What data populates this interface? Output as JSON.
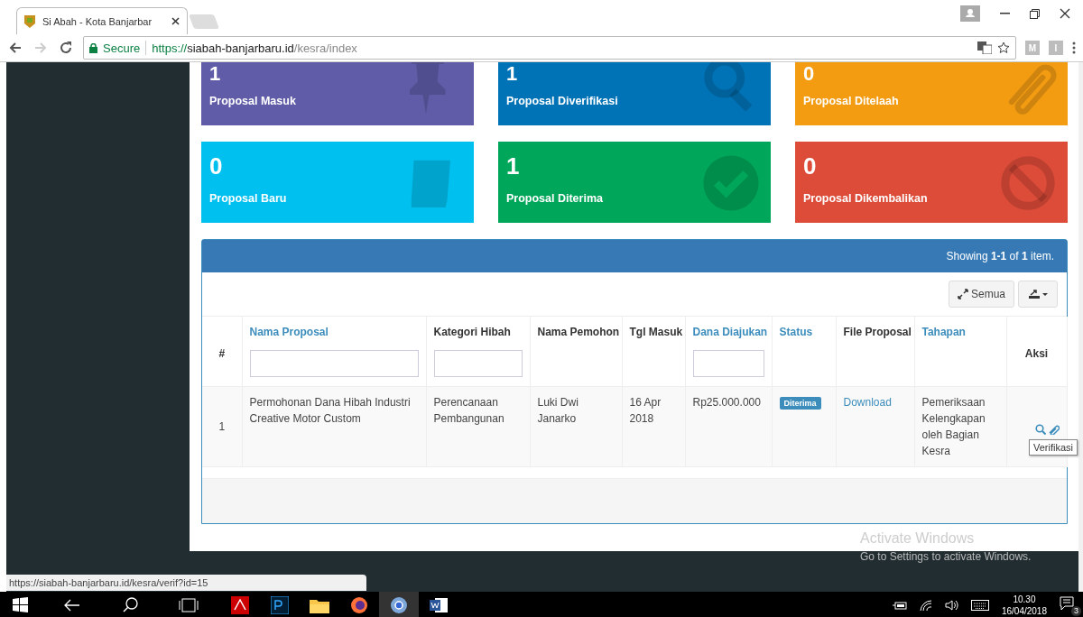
{
  "browser": {
    "tab_title": "Si Abah - Kota Banjarbar",
    "secure_label": "Secure",
    "url_scheme": "https://",
    "url_host": "siabah-banjarbaru.id",
    "url_path": "/kesra/index",
    "extensions": [
      "M",
      "I"
    ]
  },
  "tiles": [
    {
      "number": "1",
      "label": "Proposal Masuk",
      "color": "#605ca8"
    },
    {
      "number": "1",
      "label": "Proposal Diverifikasi",
      "color": "#0073b7"
    },
    {
      "number": "0",
      "label": "Proposal Ditelaah",
      "color": "#f39c12"
    },
    {
      "number": "0",
      "label": "Proposal Baru",
      "color": "#00c0ef"
    },
    {
      "number": "1",
      "label": "Proposal Diterima",
      "color": "#00a65a"
    },
    {
      "number": "0",
      "label": "Proposal Dikembalikan",
      "color": "#dd4b39"
    }
  ],
  "table": {
    "summary": "Showing **1-1** of **1** item.",
    "expand_button": "Semua",
    "columns": [
      {
        "label": "#",
        "sortable": false,
        "filter": false
      },
      {
        "label": "Nama Proposal",
        "sortable": true,
        "filter": true
      },
      {
        "label": "Kategori Hibah",
        "sortable": false,
        "filter": true
      },
      {
        "label": "Nama Pemohon",
        "sortable": false,
        "filter": false
      },
      {
        "label": "Tgl Masuk",
        "sortable": false,
        "filter": false
      },
      {
        "label": "Dana Diajukan",
        "sortable": true,
        "filter": true
      },
      {
        "label": "Status",
        "sortable": true,
        "filter": false
      },
      {
        "label": "File Proposal",
        "sortable": false,
        "filter": false
      },
      {
        "label": "Tahapan",
        "sortable": true,
        "filter": false
      },
      {
        "label": "Aksi",
        "sortable": false,
        "filter": false
      }
    ],
    "rows": [
      {
        "number": "1",
        "nama_proposal": "Permohonan Dana Hibah Industri Creative Motor Custom",
        "kategori": "Perencanaan Pembangunan",
        "pemohon": "Luki Dwi Janarko",
        "tgl_masuk": "16 Apr 2018",
        "dana": "Rp25.000.000",
        "status": "Diterima",
        "file": "Download",
        "tahapan": "Pemeriksaan Kelengkapan oleh Bagian Kesra"
      }
    ],
    "tooltip": "Verifikasi"
  },
  "status_url": "https://siabah-banjarbaru.id/kesra/verif?id=15",
  "activation_notice": {
    "title": "Activate Windows",
    "text": "Go to Settings to activate Windows."
  },
  "taskbar": {
    "apps": [
      {
        "kind": "acrobat",
        "selected": false
      },
      {
        "kind": "photoshop",
        "selected": false
      },
      {
        "kind": "explorer",
        "selected": false
      },
      {
        "kind": "firefox",
        "selected": false
      },
      {
        "kind": "chrome",
        "selected": true
      },
      {
        "kind": "word",
        "selected": false
      }
    ],
    "time": "10.30",
    "date": "16/04/2018",
    "notifications": "3"
  }
}
